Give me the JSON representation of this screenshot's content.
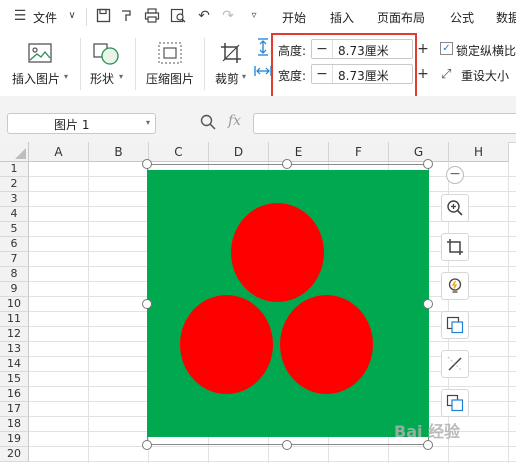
{
  "menubar": {
    "file_label": "文件",
    "tabs": [
      "开始",
      "插入",
      "页面布局",
      "公式",
      "数据"
    ]
  },
  "ribbon": {
    "insert_picture": "插入图片",
    "shape": "形状",
    "compress_picture": "压缩图片",
    "crop": "裁剪",
    "height_label": "高度:",
    "height_value": "8.73厘米",
    "width_label": "宽度:",
    "width_value": "8.73厘米",
    "lock_ratio": "锁定纵横比",
    "reset_size": "重设大小",
    "minus": "−",
    "plus": "+"
  },
  "formula_bar": {
    "name_box": "图片 1",
    "fx": "fx"
  },
  "sheet": {
    "columns": [
      "A",
      "B",
      "C",
      "D",
      "E",
      "F",
      "G",
      "H"
    ],
    "rows": [
      "1",
      "2",
      "3",
      "4",
      "5",
      "6",
      "7",
      "8",
      "9",
      "10",
      "11",
      "12",
      "13",
      "14",
      "15",
      "16",
      "17",
      "18",
      "19",
      "20"
    ]
  },
  "picture": {
    "background_color": "#00a94f",
    "circle_color": "#ff0000",
    "circle_count": 3
  },
  "side_tools": [
    "zoom-in-icon",
    "crop-icon",
    "idea-icon",
    "convert-icon",
    "edit-icon",
    "copy-icon"
  ],
  "watermark": "Bai 经验"
}
